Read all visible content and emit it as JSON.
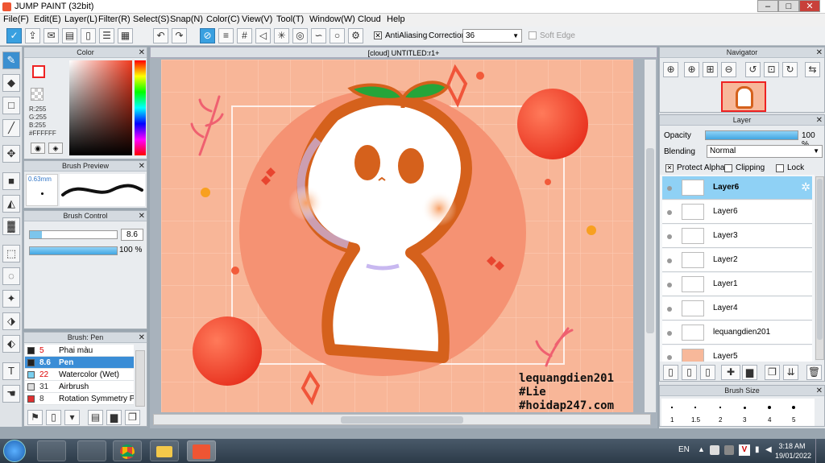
{
  "window": {
    "title": "JUMP PAINT (32bit)",
    "minimize": "–",
    "maximize": "□",
    "close": "✕"
  },
  "menu": [
    "File(F)",
    "Edit(E)",
    "Layer(L)",
    "Filter(R)",
    "Select(S)",
    "Snap(N)",
    "Color(C)",
    "View(V)",
    "Tool(T)",
    "Window(W)",
    "Cloud",
    "Help"
  ],
  "toolbar": {
    "antialiasing": "AntiAliasing",
    "correction_label": "Correction",
    "correction_value": "36",
    "soft_edge": "Soft Edge"
  },
  "color_panel": {
    "title": "Color",
    "r": "R:255",
    "g": "G:255",
    "b": "B:255",
    "hex": "#FFFFFF"
  },
  "brush_preview": {
    "title": "Brush Preview",
    "size": "0.63mm"
  },
  "brush_control": {
    "title": "Brush Control",
    "size_value": "8.6",
    "opacity_value": "100 %",
    "opacity_fraction": 1.0
  },
  "brush_list": {
    "title": "Brush: Pen",
    "items": [
      {
        "num": "5",
        "name": "Phai màu",
        "color": "#222222"
      },
      {
        "num": "8.6",
        "name": "Pen",
        "color": "#222222",
        "selected": true
      },
      {
        "num": "22",
        "name": "Watercolor (Wet)",
        "color": "#7ad0f0"
      },
      {
        "num": "31",
        "name": "Airbrush",
        "color": "#dddddd"
      },
      {
        "num": "8",
        "name": "Rotation Symmetry Pen",
        "color": "#e03030"
      }
    ]
  },
  "document": {
    "tab": "[cloud] UNTITLED:r1+"
  },
  "canvas_text": {
    "line1": "lequangdien201",
    "line2": "#Lie",
    "line3": "#hoidap247.com"
  },
  "navigator": {
    "title": "Navigator"
  },
  "layer_panel": {
    "title": "Layer",
    "opacity_label": "Opacity",
    "opacity_value": "100 %",
    "opacity_fraction": 1.0,
    "blending_label": "Blending",
    "blending_value": "Normal",
    "protect_alpha": "Protect Alpha",
    "clipping": "Clipping",
    "lock": "Lock",
    "layers": [
      {
        "name": "Layer6",
        "selected": true
      },
      {
        "name": "Layer6"
      },
      {
        "name": "Layer3"
      },
      {
        "name": "Layer2"
      },
      {
        "name": "Layer1"
      },
      {
        "name": "Layer4"
      },
      {
        "name": "lequangdien201"
      },
      {
        "name": "Layer5"
      }
    ]
  },
  "brush_size": {
    "title": "Brush Size",
    "labels": [
      "1",
      "1.5",
      "2",
      "3",
      "4",
      "5"
    ]
  },
  "taskbar": {
    "lang": "EN",
    "time": "3:18 AM",
    "date": "19/01/2022"
  }
}
